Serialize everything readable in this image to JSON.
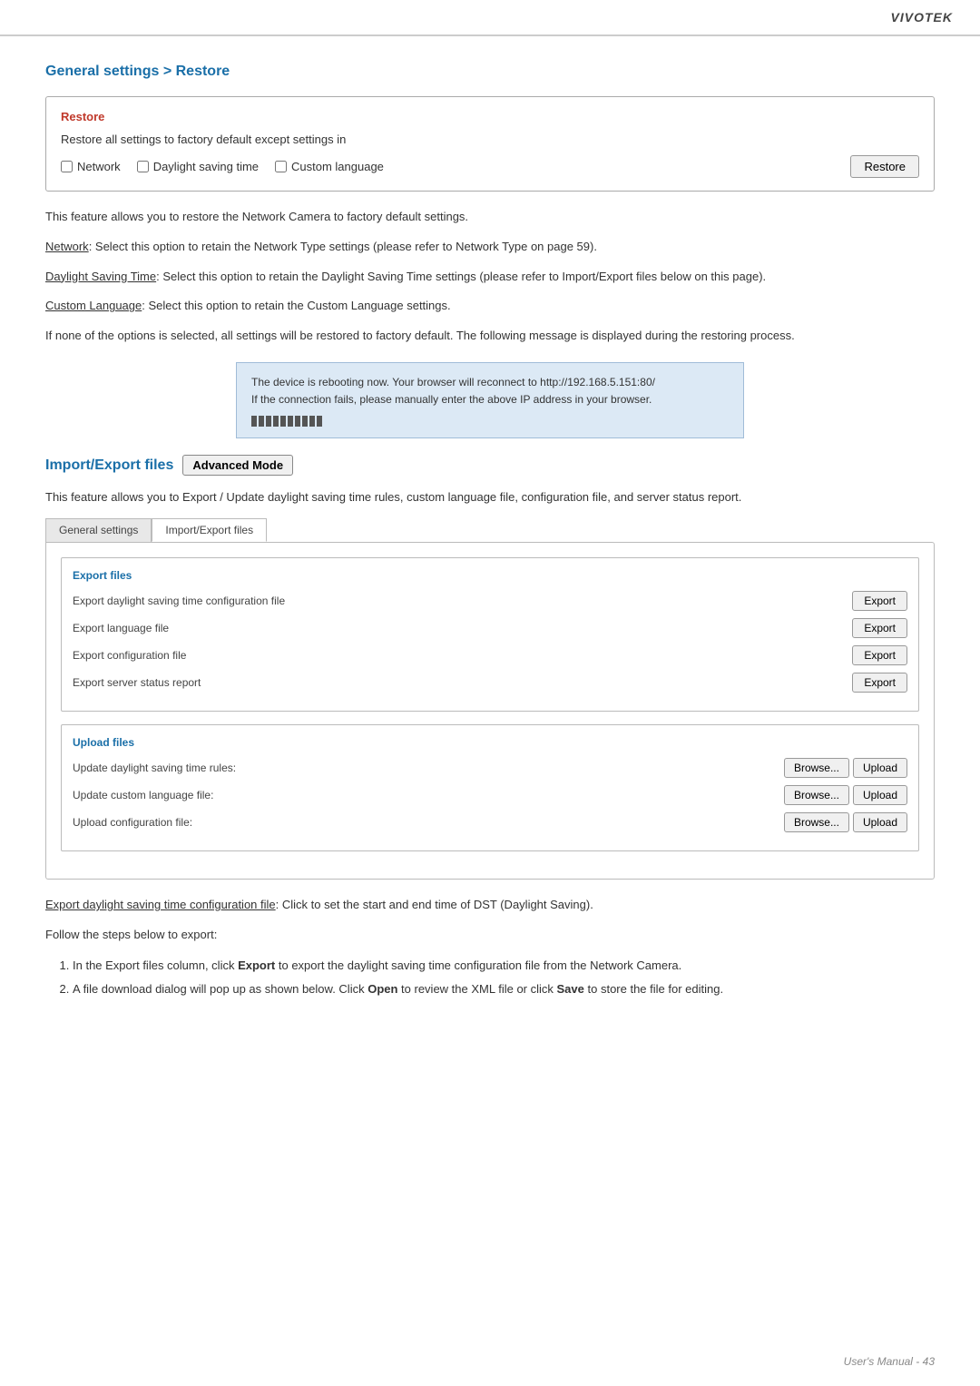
{
  "brand": "VIVOTEK",
  "section1": {
    "title": "General settings > Restore",
    "box_title": "Restore",
    "desc": "Restore all settings to factory default except settings in",
    "checkboxes": [
      "Network",
      "Daylight saving time",
      "Custom language"
    ],
    "restore_btn": "Restore"
  },
  "paragraphs": {
    "p1": "This feature allows you to restore the Network Camera to factory default settings.",
    "p2_prefix": "Network",
    "p2": ": Select this option to retain the Network Type settings (please refer to Network Type on page 59).",
    "p3_prefix": "Daylight Saving Time",
    "p3": ": Select this option to retain the Daylight Saving Time settings (please refer to Import/Export files below on this page).",
    "p4_prefix": "Custom Language",
    "p4": ": Select this option to retain the Custom Language settings.",
    "p5": "If none of the options is selected, all settings will be restored to factory default.  The following message is displayed during the restoring process."
  },
  "reboot_box": {
    "line1": "The device is rebooting now. Your browser will reconnect to http://192.168.5.151:80/",
    "line2": "If the connection fails, please manually enter the above IP address in your browser."
  },
  "section2": {
    "title": "Import/Export files",
    "advanced_mode_btn": "Advanced Mode"
  },
  "import_export_desc": "This feature allows you to Export / Update daylight saving time rules, custom language file, configuration file, and server status report.",
  "tabs": [
    "General settings",
    "Import/Export files"
  ],
  "export_files": {
    "title": "Export files",
    "rows": [
      {
        "label": "Export daylight saving time configuration file",
        "btn": "Export"
      },
      {
        "label": "Export language file",
        "btn": "Export"
      },
      {
        "label": "Export configuration file",
        "btn": "Export"
      },
      {
        "label": "Export server status report",
        "btn": "Export"
      }
    ]
  },
  "upload_files": {
    "title": "Upload files",
    "rows": [
      {
        "label": "Update daylight saving time rules:",
        "browse": "Browse...",
        "upload": "Upload"
      },
      {
        "label": "Update custom language file:",
        "browse": "Browse...",
        "upload": "Upload"
      },
      {
        "label": "Upload configuration file:",
        "browse": "Browse...",
        "upload": "Upload"
      }
    ]
  },
  "bottom_paragraphs": {
    "p1_prefix": "Export daylight saving time configuration file",
    "p1": ": Click to set the start and end time of DST (Daylight Saving).",
    "p2": "Follow the steps below to export:",
    "steps": [
      "In the Export files column, click Export to export the daylight saving time configuration file from the Network Camera.",
      "A file download dialog will pop up as shown below. Click Open to review the XML file or click Save to store the file for editing."
    ],
    "step1_bold": "Export",
    "step1_suffix": " to export the daylight saving time configuration file from the Network Camera.",
    "step1_prefix": "In the Export files column, click ",
    "step2_bold1": "Open",
    "step2_bold2": "Save",
    "step2_prefix": "A file download dialog will pop up as shown below. Click ",
    "step2_mid": " to review the XML file or click ",
    "step2_suffix": " to store the file for editing."
  },
  "footer": "User's Manual - 43"
}
